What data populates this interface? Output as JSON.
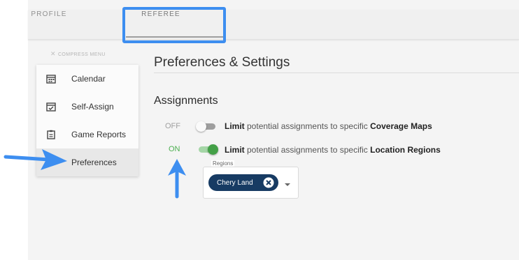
{
  "tabs": [
    {
      "label": "PROFILE"
    },
    {
      "label": "REFEREE"
    }
  ],
  "sidebar": {
    "compress_label": "COMPRESS MENU",
    "items": [
      {
        "label": "Calendar",
        "icon": "calendar-icon"
      },
      {
        "label": "Self-Assign",
        "icon": "calendar-check-icon"
      },
      {
        "label": "Game Reports",
        "icon": "clipboard-icon"
      },
      {
        "label": "Preferences",
        "icon": "preferences-icon",
        "active": true
      }
    ]
  },
  "content": {
    "title": "Preferences & Settings",
    "section_title": "Assignments",
    "settings": [
      {
        "state": "OFF",
        "enabled": false,
        "text_bold_1": "Limit",
        "text_mid": " potential assignments to specific ",
        "text_bold_2": "Coverage Maps"
      },
      {
        "state": "ON",
        "enabled": true,
        "text_bold_1": "Limit",
        "text_mid": " potential assignments to specific ",
        "text_bold_2": "Location Regions"
      }
    ],
    "regions": {
      "label": "Regions",
      "selected": [
        "Chery Land"
      ]
    }
  },
  "colors": {
    "highlight": "#3d8ef0",
    "toggle_on": "#43a047",
    "chip": "#173b63",
    "annotation_arrow": "#3d8ef0"
  }
}
